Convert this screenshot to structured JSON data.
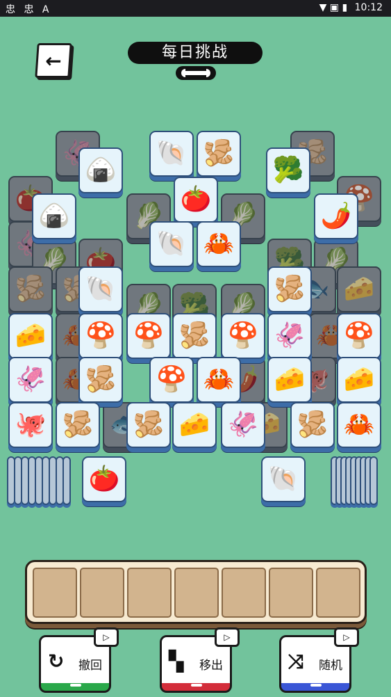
{
  "status_bar": {
    "left_icons": "忠 忠 A",
    "right_icons": "▼ ▣ ▮",
    "time": "10:12"
  },
  "header": {
    "back_icon": "arrow-left-icon",
    "title": "每日挑战",
    "link_icon": "chain-link-icon"
  },
  "tray": {
    "slot_count": 7,
    "slots": [
      "",
      "",
      "",
      "",
      "",
      "",
      ""
    ]
  },
  "buttons": [
    {
      "name": "undo",
      "label": "撤回",
      "icon": "↻",
      "video_icon": "▷",
      "accent": "#2aa84a"
    },
    {
      "name": "move-out",
      "label": "移出",
      "icon": "▚",
      "video_icon": "▷",
      "accent": "#d32d3a"
    },
    {
      "name": "shuffle",
      "label": "随机",
      "icon": "⤨",
      "video_icon": "▷",
      "accent": "#3a56d6"
    }
  ],
  "tile_glyphs": {
    "tomato": "🍅",
    "onigiri": "🍙",
    "shellfish": "🐚",
    "ginger": "🫚",
    "broccoli": "🥦",
    "chili": "🌶️",
    "crab": "🦀",
    "mushroom": "🍄",
    "cheese": "🧀",
    "fish": "🐟",
    "octopus": "🐙",
    "bokchoy": "🥬",
    "squid": "🦑"
  },
  "tiles": [
    {
      "item": "squid",
      "dim": true
    },
    {
      "item": "ginger",
      "dim": true
    },
    {
      "item": "onigiri",
      "dim": false
    },
    {
      "item": "shellfish",
      "dim": false
    },
    {
      "item": "ginger",
      "dim": false
    },
    {
      "item": "broccoli",
      "dim": false
    },
    {
      "item": "tomato",
      "dim": true
    },
    {
      "item": "onigiri",
      "dim": false
    },
    {
      "item": "bokchoy",
      "dim": true
    },
    {
      "item": "tomato",
      "dim": false
    },
    {
      "item": "bokchoy",
      "dim": true
    },
    {
      "item": "mushroom",
      "dim": true
    },
    {
      "item": "chili",
      "dim": false
    },
    {
      "item": "squid",
      "dim": true
    },
    {
      "item": "bokchoy",
      "dim": true
    },
    {
      "item": "tomato",
      "dim": true
    },
    {
      "item": "shellfish",
      "dim": false
    },
    {
      "item": "crab",
      "dim": false
    },
    {
      "item": "broccoli",
      "dim": true
    },
    {
      "item": "bokchoy",
      "dim": true
    },
    {
      "item": "fish",
      "dim": true
    },
    {
      "item": "ginger",
      "dim": true
    },
    {
      "item": "ginger",
      "dim": true
    },
    {
      "item": "shellfish",
      "dim": false
    },
    {
      "item": "bokchoy",
      "dim": true
    },
    {
      "item": "broccoli",
      "dim": true
    },
    {
      "item": "bokchoy",
      "dim": true
    },
    {
      "item": "ginger",
      "dim": false
    },
    {
      "item": "fish",
      "dim": true
    },
    {
      "item": "cheese",
      "dim": true
    },
    {
      "item": "cheese",
      "dim": false
    },
    {
      "item": "crab",
      "dim": true
    },
    {
      "item": "mushroom",
      "dim": false
    },
    {
      "item": "mushroom",
      "dim": false
    },
    {
      "item": "ginger",
      "dim": false
    },
    {
      "item": "mushroom",
      "dim": false
    },
    {
      "item": "squid",
      "dim": false
    },
    {
      "item": "crab",
      "dim": true
    },
    {
      "item": "mushroom",
      "dim": false
    },
    {
      "item": "squid",
      "dim": false
    },
    {
      "item": "crab",
      "dim": true
    },
    {
      "item": "ginger",
      "dim": false
    },
    {
      "item": "mushroom",
      "dim": false
    },
    {
      "item": "crab",
      "dim": false
    },
    {
      "item": "chili",
      "dim": true
    },
    {
      "item": "cheese",
      "dim": false
    },
    {
      "item": "octopus",
      "dim": true
    },
    {
      "item": "cheese",
      "dim": false
    },
    {
      "item": "octopus",
      "dim": false
    },
    {
      "item": "ginger",
      "dim": false
    },
    {
      "item": "fish",
      "dim": true
    },
    {
      "item": "ginger",
      "dim": false
    },
    {
      "item": "cheese",
      "dim": false
    },
    {
      "item": "squid",
      "dim": false
    },
    {
      "item": "cheese",
      "dim": true
    },
    {
      "item": "ginger",
      "dim": false
    },
    {
      "item": "crab",
      "dim": false
    }
  ],
  "stacks": [
    {
      "top_item": "tomato"
    },
    {
      "top_item": "shellfish"
    }
  ]
}
